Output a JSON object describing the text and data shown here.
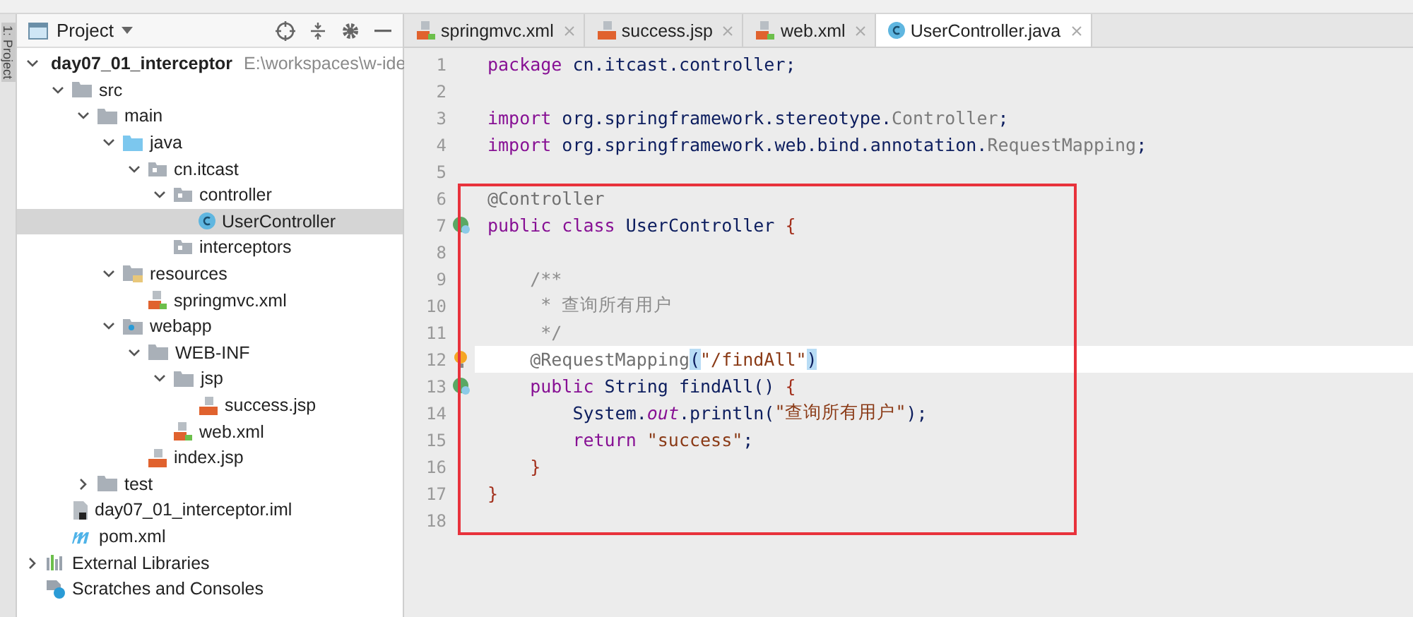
{
  "sidebar_strip": {
    "label": "1: Project"
  },
  "project_panel": {
    "title": "Project",
    "tree": [
      {
        "label": "day07_01_interceptor",
        "hint": "E:\\workspaces\\w-ide",
        "kind": "module",
        "bold": true,
        "expanded": true,
        "selected": false,
        "children": [
          {
            "label": "src",
            "kind": "folder",
            "expanded": true,
            "selected": false,
            "children": [
              {
                "label": "main",
                "kind": "folder",
                "expanded": true,
                "selected": false,
                "children": [
                  {
                    "label": "java",
                    "kind": "source",
                    "expanded": true,
                    "selected": false,
                    "children": [
                      {
                        "label": "cn.itcast",
                        "kind": "package",
                        "expanded": true,
                        "selected": false,
                        "children": [
                          {
                            "label": "controller",
                            "kind": "package",
                            "expanded": true,
                            "selected": false,
                            "children": [
                              {
                                "label": "UserController",
                                "kind": "class",
                                "selected": true
                              }
                            ]
                          },
                          {
                            "label": "interceptors",
                            "kind": "package",
                            "selected": false
                          }
                        ]
                      }
                    ]
                  },
                  {
                    "label": "resources",
                    "kind": "resources",
                    "expanded": true,
                    "selected": false,
                    "children": [
                      {
                        "label": "springmvc.xml",
                        "kind": "xml",
                        "selected": false
                      }
                    ]
                  },
                  {
                    "label": "webapp",
                    "kind": "web",
                    "expanded": true,
                    "selected": false,
                    "children": [
                      {
                        "label": "WEB-INF",
                        "kind": "folder",
                        "expanded": true,
                        "selected": false,
                        "children": [
                          {
                            "label": "jsp",
                            "kind": "folder",
                            "expanded": true,
                            "selected": false,
                            "children": [
                              {
                                "label": "success.jsp",
                                "kind": "jsp",
                                "selected": false
                              }
                            ]
                          },
                          {
                            "label": "web.xml",
                            "kind": "xml",
                            "selected": false
                          }
                        ]
                      },
                      {
                        "label": "index.jsp",
                        "kind": "jsp",
                        "selected": false
                      }
                    ]
                  }
                ]
              },
              {
                "label": "test",
                "kind": "folder",
                "expanded": false,
                "selected": false
              }
            ]
          },
          {
            "label": "day07_01_interceptor.iml",
            "kind": "iml",
            "selected": false
          },
          {
            "label": "pom.xml",
            "kind": "maven",
            "selected": false
          }
        ]
      },
      {
        "label": "External Libraries",
        "kind": "libraries",
        "expanded": false,
        "selected": false
      },
      {
        "label": "Scratches and Consoles",
        "kind": "scratches",
        "selected": false
      }
    ]
  },
  "editor": {
    "tabs": [
      {
        "label": "springmvc.xml",
        "kind": "xml",
        "selected": false
      },
      {
        "label": "success.jsp",
        "kind": "jsp",
        "selected": false
      },
      {
        "label": "web.xml",
        "kind": "xml",
        "selected": false
      },
      {
        "label": "UserController.java",
        "kind": "class",
        "selected": true
      }
    ],
    "lines": [
      {
        "number": "1",
        "kind": "code",
        "tokens": [
          {
            "kind": "kw",
            "t": "package"
          },
          {
            "kind": "plain",
            "t": " cn.itcast.controller;"
          }
        ]
      },
      {
        "number": "2",
        "kind": "code"
      },
      {
        "number": "3",
        "kind": "code",
        "tokens": [
          {
            "kind": "kw",
            "t": "import"
          },
          {
            "kind": "plain",
            "t": " org.springframework.stereotype."
          },
          {
            "kind": "dim",
            "t": "Controller"
          },
          {
            "kind": "plain",
            "t": ";"
          }
        ]
      },
      {
        "number": "4",
        "kind": "code",
        "tokens": [
          {
            "kind": "kw",
            "t": "import"
          },
          {
            "kind": "plain",
            "t": " org.springframework.web.bind.annotation."
          },
          {
            "kind": "dim",
            "t": "RequestMapping"
          },
          {
            "kind": "plain",
            "t": ";"
          }
        ]
      },
      {
        "number": "5",
        "kind": "code"
      }
    ],
    "highlighted_block": {
      "lines": [
        {
          "number": "6",
          "kind": "code",
          "tokens": [
            {
              "kind": "ann",
              "t": "@Controller"
            }
          ]
        },
        {
          "number": "7",
          "kind": "bean",
          "tokens": [
            {
              "kind": "kw",
              "t": "public class"
            },
            {
              "kind": "plain",
              "t": " UserController "
            },
            {
              "kind": "brace",
              "t": "{"
            }
          ]
        },
        {
          "number": "8",
          "kind": "code"
        },
        {
          "number": "9",
          "kind": "code",
          "tokens": [
            {
              "kind": "comment",
              "t": "    /**"
            }
          ]
        },
        {
          "number": "10",
          "kind": "code",
          "tokens": [
            {
              "kind": "comment",
              "t": "     * 查询所有用户"
            }
          ]
        },
        {
          "number": "11",
          "kind": "code",
          "tokens": [
            {
              "kind": "comment",
              "t": "     */"
            }
          ]
        },
        {
          "number": "12",
          "kind": "bulb",
          "current": true,
          "tokens": [
            {
              "kind": "ann",
              "t": "    @RequestMapping"
            },
            {
              "kind": "match",
              "t": "("
            },
            {
              "kind": "str",
              "t": "\"/findAll\""
            },
            {
              "kind": "match",
              "t": ")"
            }
          ]
        },
        {
          "number": "13",
          "kind": "bean",
          "tokens": [
            {
              "kind": "kw",
              "t": "    public"
            },
            {
              "kind": "plain",
              "t": " String findAll() "
            },
            {
              "kind": "brace",
              "t": "{"
            }
          ]
        },
        {
          "number": "14",
          "kind": "code",
          "tokens": [
            {
              "kind": "plain",
              "t": "        System."
            },
            {
              "kind": "field",
              "t": "out"
            },
            {
              "kind": "plain",
              "t": ".println("
            },
            {
              "kind": "str",
              "t": "\"查询所有用户\""
            },
            {
              "kind": "plain",
              "t": ");"
            }
          ]
        },
        {
          "number": "15",
          "kind": "code",
          "tokens": [
            {
              "kind": "kw",
              "t": "        return"
            },
            {
              "kind": "str",
              "t": " \"success\""
            },
            {
              "kind": "plain",
              "t": ";"
            }
          ]
        },
        {
          "number": "16",
          "kind": "code",
          "tokens": [
            {
              "kind": "brace",
              "t": "    }"
            }
          ]
        },
        {
          "number": "17",
          "kind": "code",
          "tokens": [
            {
              "kind": "brace",
              "t": "}"
            }
          ]
        },
        {
          "number": "18",
          "kind": "code"
        }
      ]
    }
  }
}
